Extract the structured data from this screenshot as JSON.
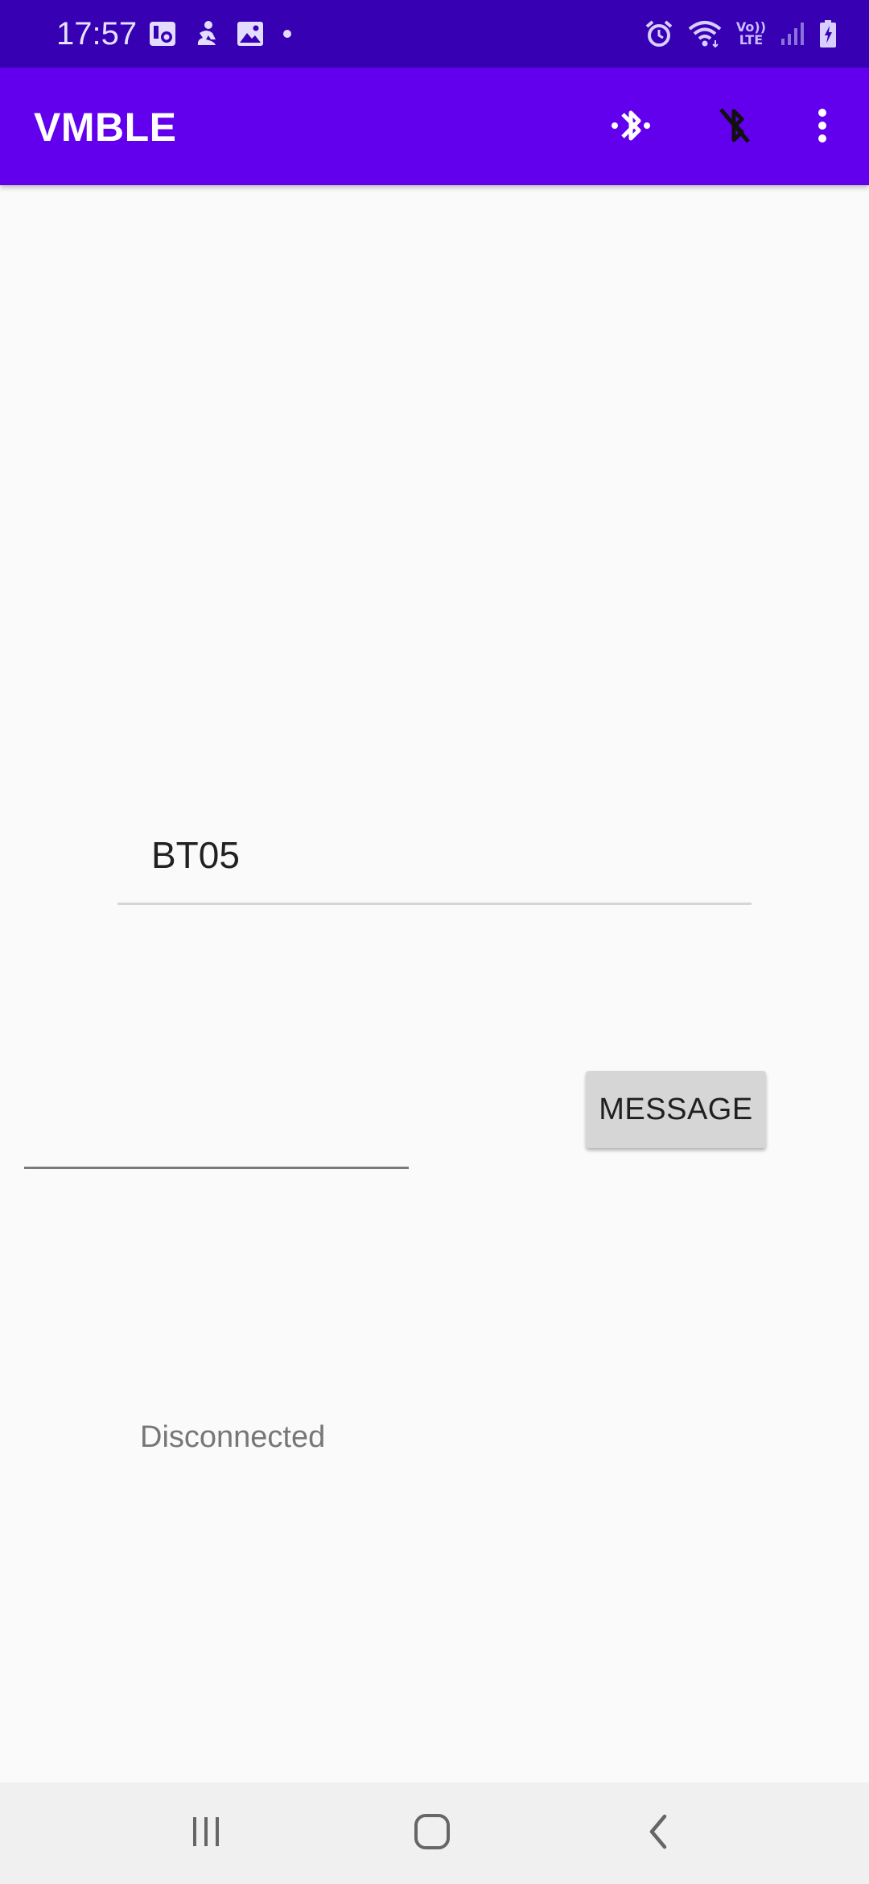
{
  "status_bar": {
    "time": "17:57",
    "left_icons": [
      "gallery-icon",
      "fitness-icon",
      "image-icon",
      "dot-icon"
    ],
    "right_icons": [
      "alarm-icon",
      "wifi-icon",
      "volte-icon",
      "signal-icon",
      "battery-icon"
    ],
    "volte_top": "Vo))",
    "volte_bottom": "LTE"
  },
  "app_bar": {
    "title": "VMBLE",
    "actions": [
      "bluetooth-scan-icon",
      "bluetooth-disabled-icon",
      "more-vert-icon"
    ],
    "background": "#6200ee"
  },
  "main": {
    "device_name": "BT05",
    "message_input_value": "",
    "message_button_label": "MESSAGE",
    "connection_status": "Disconnected"
  },
  "nav_bar": {
    "buttons": [
      "recents-icon",
      "home-icon",
      "back-icon"
    ]
  },
  "colors": {
    "status_bar": "#3700b3",
    "app_bar": "#6200ee",
    "background": "#fafafa"
  }
}
